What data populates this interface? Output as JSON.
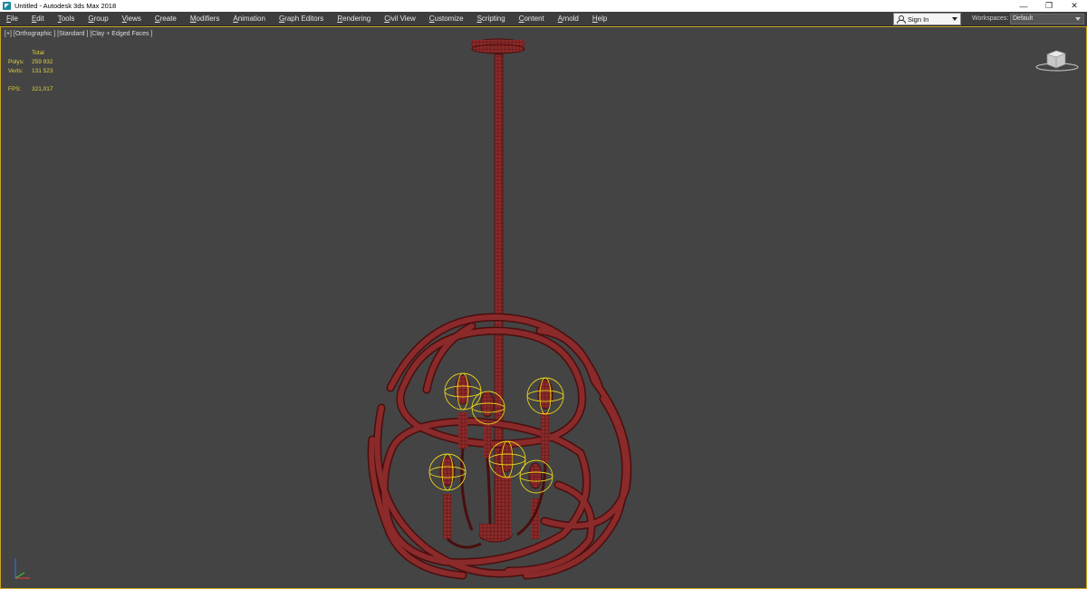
{
  "window": {
    "title": "Untitled - Autodesk 3ds Max 2018",
    "minimize_glyph": "—",
    "restore_glyph": "❐",
    "close_glyph": "✕"
  },
  "menu": {
    "items": [
      "File",
      "Edit",
      "Tools",
      "Group",
      "Views",
      "Create",
      "Modifiers",
      "Animation",
      "Graph Editors",
      "Rendering",
      "Civil View",
      "Customize",
      "Scripting",
      "Content",
      "Arnold",
      "Help"
    ]
  },
  "account": {
    "sign_in_label": "Sign In"
  },
  "workspaces": {
    "label": "Workspaces:",
    "selected": "Default"
  },
  "viewport": {
    "label": "[+] [Orthographic ] [Standard ] [Clay + Edged Faces ]",
    "stats": {
      "header": "Total",
      "polys_label": "Polys:",
      "polys_value": "259 932",
      "verts_label": "Verts:",
      "verts_value": "131 523",
      "fps_label": "FPS:",
      "fps_value": "321,017"
    }
  },
  "colors": {
    "viewport_bg": "#444444",
    "active_border": "#c9a420",
    "wire": "#7a1e1e",
    "wire_dark": "#4a0e0e",
    "light_gizmo": "#e8d21a",
    "stats_text": "#e0d040"
  },
  "icons": {
    "app": "3ds-max-icon",
    "user": "user-icon",
    "viewcube": "viewcube-icon",
    "axis": "axis-tripod-icon"
  }
}
